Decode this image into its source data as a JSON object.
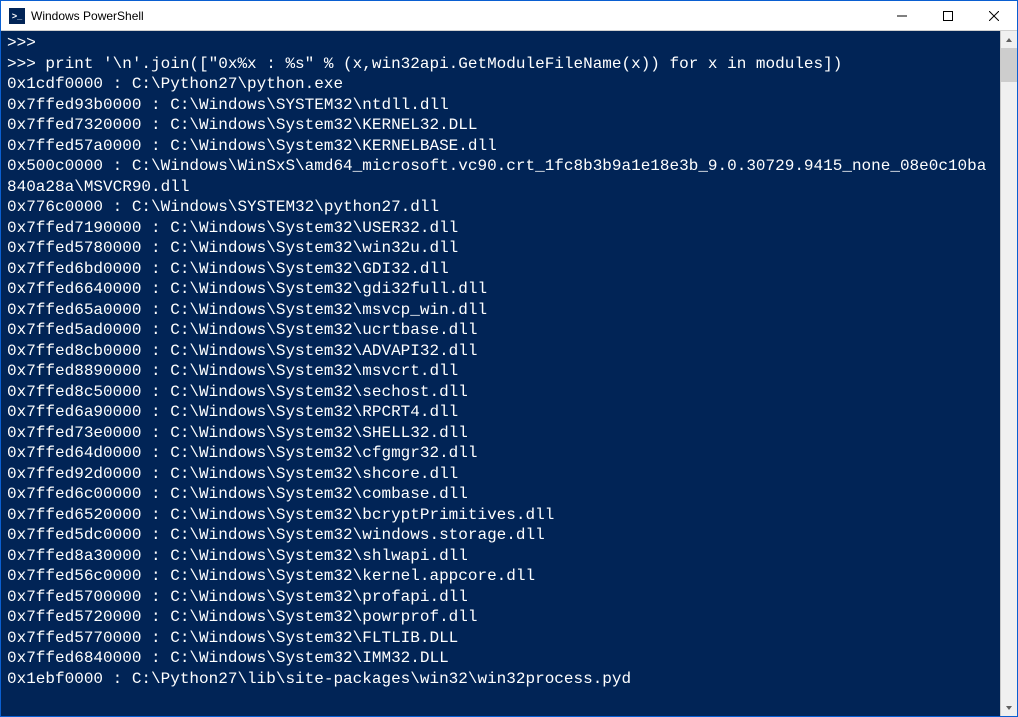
{
  "window": {
    "title": "Windows PowerShell",
    "icon_label": ">_"
  },
  "terminal": {
    "lines": [
      ">>>",
      ">>> print '\\n'.join([\"0x%x : %s\" % (x,win32api.GetModuleFileName(x)) for x in modules])",
      "0x1cdf0000 : C:\\Python27\\python.exe",
      "0x7ffed93b0000 : C:\\Windows\\SYSTEM32\\ntdll.dll",
      "0x7ffed7320000 : C:\\Windows\\System32\\KERNEL32.DLL",
      "0x7ffed57a0000 : C:\\Windows\\System32\\KERNELBASE.dll",
      "0x500c0000 : C:\\Windows\\WinSxS\\amd64_microsoft.vc90.crt_1fc8b3b9a1e18e3b_9.0.30729.9415_none_08e0c10ba840a28a\\MSVCR90.dll",
      "0x776c0000 : C:\\Windows\\SYSTEM32\\python27.dll",
      "0x7ffed7190000 : C:\\Windows\\System32\\USER32.dll",
      "0x7ffed5780000 : C:\\Windows\\System32\\win32u.dll",
      "0x7ffed6bd0000 : C:\\Windows\\System32\\GDI32.dll",
      "0x7ffed6640000 : C:\\Windows\\System32\\gdi32full.dll",
      "0x7ffed65a0000 : C:\\Windows\\System32\\msvcp_win.dll",
      "0x7ffed5ad0000 : C:\\Windows\\System32\\ucrtbase.dll",
      "0x7ffed8cb0000 : C:\\Windows\\System32\\ADVAPI32.dll",
      "0x7ffed8890000 : C:\\Windows\\System32\\msvcrt.dll",
      "0x7ffed8c50000 : C:\\Windows\\System32\\sechost.dll",
      "0x7ffed6a90000 : C:\\Windows\\System32\\RPCRT4.dll",
      "0x7ffed73e0000 : C:\\Windows\\System32\\SHELL32.dll",
      "0x7ffed64d0000 : C:\\Windows\\System32\\cfgmgr32.dll",
      "0x7ffed92d0000 : C:\\Windows\\System32\\shcore.dll",
      "0x7ffed6c00000 : C:\\Windows\\System32\\combase.dll",
      "0x7ffed6520000 : C:\\Windows\\System32\\bcryptPrimitives.dll",
      "0x7ffed5dc0000 : C:\\Windows\\System32\\windows.storage.dll",
      "0x7ffed8a30000 : C:\\Windows\\System32\\shlwapi.dll",
      "0x7ffed56c0000 : C:\\Windows\\System32\\kernel.appcore.dll",
      "0x7ffed5700000 : C:\\Windows\\System32\\profapi.dll",
      "0x7ffed5720000 : C:\\Windows\\System32\\powrprof.dll",
      "0x7ffed5770000 : C:\\Windows\\System32\\FLTLIB.DLL",
      "0x7ffed6840000 : C:\\Windows\\System32\\IMM32.DLL",
      "0x1ebf0000 : C:\\Python27\\lib\\site-packages\\win32\\win32process.pyd"
    ]
  }
}
